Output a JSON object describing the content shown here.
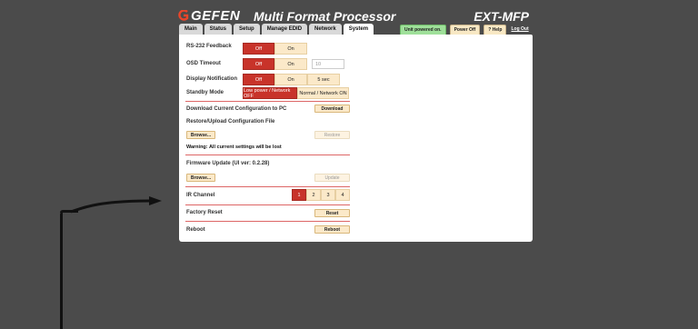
{
  "header": {
    "brand": "GEFEN",
    "product": "Multi Format Processor",
    "model": "EXT-MFP"
  },
  "tabs": [
    {
      "label": "Main"
    },
    {
      "label": "Status"
    },
    {
      "label": "Setup"
    },
    {
      "label": "Manage EDID"
    },
    {
      "label": "Network"
    },
    {
      "label": "System",
      "active": true
    }
  ],
  "status": {
    "powered": "Unit powered on.",
    "power_off": "Power Off",
    "help": "? Help",
    "logout": "Log Out"
  },
  "system": {
    "rs232": {
      "label": "RS-232 Feedback",
      "off": "Off",
      "on": "On"
    },
    "osd": {
      "label": "OSD Timeout",
      "off": "Off",
      "on": "On",
      "placeholder": "10"
    },
    "display": {
      "label": "Display Notification",
      "off": "Off",
      "on": "On",
      "sec": "5 sec"
    },
    "standby": {
      "label": "Standby Mode",
      "low": "Low power / Network OFF",
      "normal": "Normal / Network ON"
    },
    "download": {
      "label": "Download Current Configuration to PC",
      "button": "Download"
    },
    "restore": {
      "label": "Restore/Upload Configuration File",
      "browse": "Browse...",
      "button": "Restore",
      "warning": "Warning: All current settings will be lost"
    },
    "firmware": {
      "label": "Firmware Update (UI ver: 0.2.28)",
      "browse": "Browse...",
      "button": "Update"
    },
    "ir": {
      "label": "IR Channel",
      "channels": [
        "1",
        "2",
        "3",
        "4"
      ],
      "selected": "1"
    },
    "factory": {
      "label": "Factory Reset",
      "button": "Reset"
    },
    "reboot": {
      "label": "Reboot",
      "button": "Reboot"
    }
  },
  "colors": {
    "accent": "#c8332a",
    "background": "#4b4b4b"
  }
}
